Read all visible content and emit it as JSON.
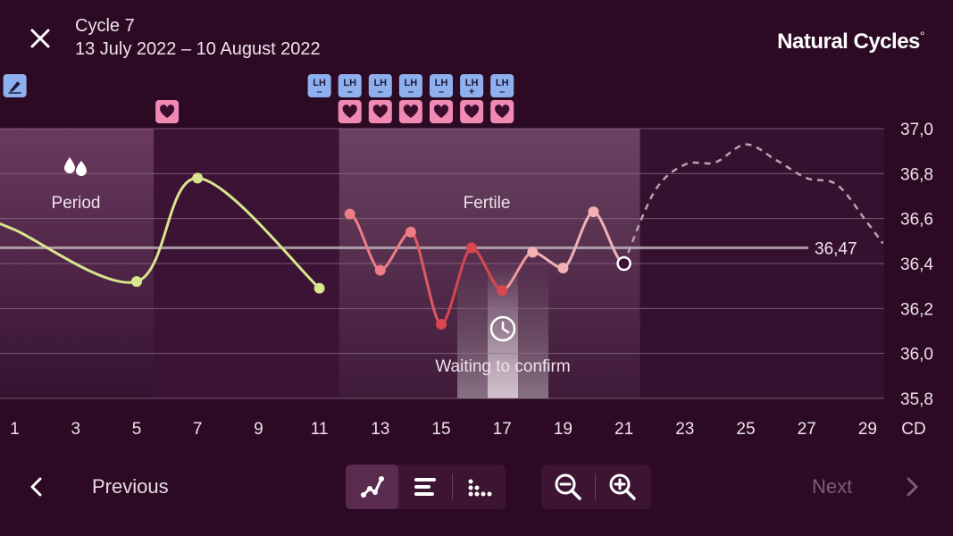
{
  "header": {
    "cycle_title": "Cycle 7",
    "cycle_dates": "13 July 2022 – 10 August 2022",
    "logo_text": "Natural Cycles",
    "logo_mark": "°"
  },
  "markers": {
    "top_row": [
      {
        "day": 1,
        "type": "note",
        "icon": "pen-icon"
      },
      {
        "day": 11,
        "type": "lh",
        "label": "LH",
        "sign": "–"
      },
      {
        "day": 12,
        "type": "lh",
        "label": "LH",
        "sign": "–"
      },
      {
        "day": 13,
        "type": "lh",
        "label": "LH",
        "sign": "–"
      },
      {
        "day": 14,
        "type": "lh",
        "label": "LH",
        "sign": "–"
      },
      {
        "day": 15,
        "type": "lh",
        "label": "LH",
        "sign": "–"
      },
      {
        "day": 16,
        "type": "lh",
        "label": "LH",
        "sign": "+"
      },
      {
        "day": 17,
        "type": "lh",
        "label": "LH",
        "sign": "–"
      }
    ],
    "heart_days": [
      6,
      12,
      13,
      14,
      15,
      16,
      17
    ]
  },
  "chart_data": {
    "type": "line",
    "title": "",
    "xlabel": "CD",
    "ylabel": "",
    "x_ticks": [
      1,
      3,
      5,
      7,
      9,
      11,
      13,
      15,
      17,
      19,
      21,
      23,
      25,
      27,
      29
    ],
    "x_axis_label": "CD",
    "y_ticks": [
      "37,0",
      "36,8",
      "36,6",
      "36,4",
      "36,2",
      "36,0",
      "35,8"
    ],
    "ylim": [
      35.8,
      37.0
    ],
    "xlim": [
      1,
      29
    ],
    "coverline": {
      "value": 36.47,
      "label": "36,47"
    },
    "regions": [
      {
        "label": "Period",
        "icon": "drops-icon",
        "from": 0.5,
        "to": 5.5
      },
      {
        "label": "Fertile",
        "from": 11.5,
        "to": 21.5
      },
      {
        "label": "Waiting to confirm",
        "icon": "clock-icon",
        "from": 15.5,
        "to": 18.5
      }
    ],
    "series": [
      {
        "values": [
          {
            "day": 5,
            "temp": 36.32,
            "phase": "infertile"
          },
          {
            "day": 7,
            "temp": 36.78,
            "phase": "infertile"
          },
          {
            "day": 11,
            "temp": 36.29,
            "phase": "infertile"
          },
          {
            "day": 12,
            "temp": 36.62,
            "phase": "fertile"
          },
          {
            "day": 13,
            "temp": 36.37,
            "phase": "fertile"
          },
          {
            "day": 14,
            "temp": 36.54,
            "phase": "fertile"
          },
          {
            "day": 15,
            "temp": 36.13,
            "phase": "fertile-high"
          },
          {
            "day": 16,
            "temp": 36.47,
            "phase": "fertile-high"
          },
          {
            "day": 17,
            "temp": 36.28,
            "phase": "fertile-high"
          },
          {
            "day": 18,
            "temp": 36.45,
            "phase": "fertile-light"
          },
          {
            "day": 19,
            "temp": 36.38,
            "phase": "fertile-light"
          },
          {
            "day": 20,
            "temp": 36.63,
            "phase": "fertile-light"
          },
          {
            "day": 21,
            "temp": 36.4,
            "phase": "today"
          }
        ]
      },
      {
        "style": "dashed-prediction",
        "values": [
          {
            "day": 21,
            "temp": 36.4
          },
          {
            "day": 22,
            "temp": 36.72
          },
          {
            "day": 23,
            "temp": 36.84
          },
          {
            "day": 24,
            "temp": 36.85
          },
          {
            "day": 25,
            "temp": 36.93
          },
          {
            "day": 26,
            "temp": 36.86
          },
          {
            "day": 27,
            "temp": 36.78
          },
          {
            "day": 28,
            "temp": 36.75
          },
          {
            "day": 29,
            "temp": 36.58
          },
          {
            "day": 29.5,
            "temp": 36.49
          }
        ]
      }
    ],
    "colors": {
      "infertile": "#d8e58c",
      "fertile": "#ee7c84",
      "fertile_high": "#d8474f",
      "fertile_light": "#f4b1b4",
      "prediction": "#b8a4b2",
      "coverline": "#bdb1b9",
      "lh_badge": "#8fb0ef",
      "heart_badge": "#f08ab3",
      "note_badge": "#8fb0ef"
    }
  },
  "footer": {
    "previous_label": "Previous",
    "next_label": "Next",
    "view_buttons": [
      {
        "name": "graph-view",
        "icon": "line-graph-icon",
        "active": true
      },
      {
        "name": "list-view",
        "icon": "list-icon",
        "active": false
      },
      {
        "name": "grid-view",
        "icon": "dots-grid-icon",
        "active": false
      }
    ],
    "zoom_buttons": [
      {
        "name": "zoom-out",
        "icon": "zoom-out-icon"
      },
      {
        "name": "zoom-in",
        "icon": "zoom-in-icon"
      }
    ]
  }
}
